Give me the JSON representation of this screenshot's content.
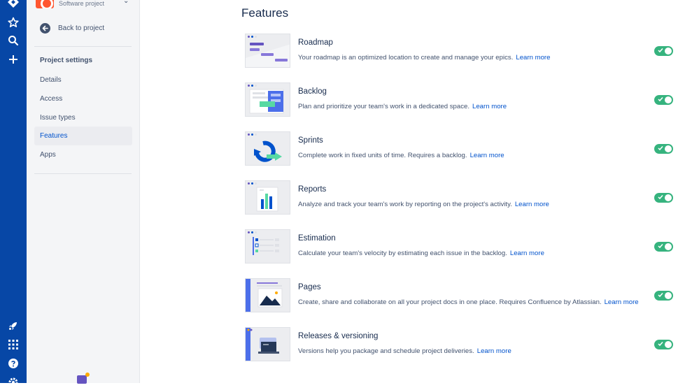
{
  "sidebar": {
    "project_type": "Software project",
    "back_label": "Back to project",
    "section_title": "Project settings",
    "items": [
      {
        "label": "Details"
      },
      {
        "label": "Access"
      },
      {
        "label": "Issue types"
      },
      {
        "label": "Features",
        "active": true
      },
      {
        "label": "Apps"
      }
    ]
  },
  "main": {
    "title": "Features",
    "features": [
      {
        "name": "Roadmap",
        "description": "Your roadmap is an optimized location to create and manage your epics.",
        "link": "Learn more",
        "enabled": true
      },
      {
        "name": "Backlog",
        "description": "Plan and prioritize your team's work in a dedicated space.",
        "link": "Learn more",
        "enabled": true
      },
      {
        "name": "Sprints",
        "description": "Complete work in fixed units of time. Requires a backlog.",
        "link": "Learn more",
        "enabled": true
      },
      {
        "name": "Reports",
        "description": "Analyze and track your team's work by reporting on the project's activity.",
        "link": "Learn more",
        "enabled": true
      },
      {
        "name": "Estimation",
        "description": "Calculate your team's velocity by estimating each issue in the backlog.",
        "link": "Learn more",
        "enabled": true
      },
      {
        "name": "Pages",
        "description": "Create, share and collaborate on all your project docs in one place. Requires Confluence by Atlassian.",
        "link": "Learn more",
        "enabled": true
      },
      {
        "name": "Releases & versioning",
        "description": "Versions help you package and schedule project deliveries.",
        "link": "Learn more",
        "enabled": true
      }
    ]
  },
  "colors": {
    "nav": "#0747A6",
    "toggle_on": "#36B37E",
    "link": "#0052CC",
    "accent_purple": "#6554C0"
  },
  "icons": [
    "jira-logo-icon",
    "star-icon",
    "search-icon",
    "plus-icon",
    "rocket-icon",
    "app-switcher-icon",
    "help-icon",
    "settings-icon"
  ]
}
